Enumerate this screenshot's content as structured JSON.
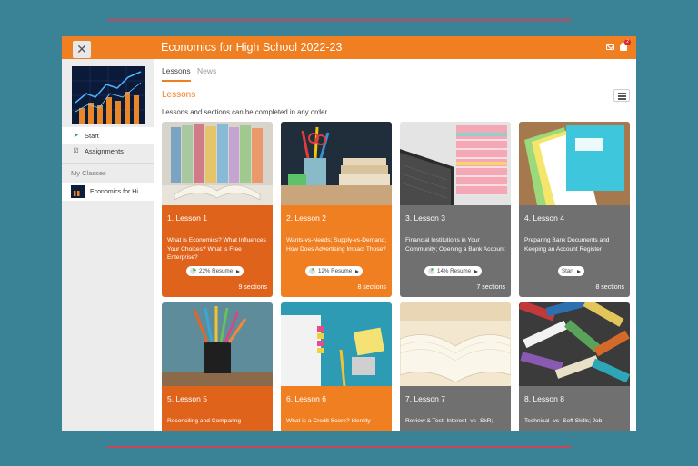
{
  "header": {
    "close_label": "✕",
    "title": "Economics for High School 2022-23",
    "notification_count": "2"
  },
  "sidebar": {
    "items": [
      {
        "label": "Start",
        "icon": "navigate-arrow-icon"
      },
      {
        "label": "Assignments",
        "icon": "checkbox-icon"
      }
    ],
    "my_classes_label": "My Classes",
    "classes": [
      {
        "label": "Economics for Hi"
      }
    ]
  },
  "tabs": [
    {
      "label": "Lessons",
      "active": true
    },
    {
      "label": "News",
      "active": false
    }
  ],
  "main": {
    "section_title": "Lessons",
    "helper_text": "Lessons and sections can be completed in any order."
  },
  "lessons": [
    {
      "title": "1. Lesson 1",
      "description": "What is Economics? What Influences Your Choices? What is Free Enterprise?",
      "button": "22% Resume",
      "progress": 22,
      "sections": "9 sections"
    },
    {
      "title": "2. Lesson 2",
      "description": "Wants-vs-Needs; Supply-vs-Demand; How Does Advertising Impact Those?",
      "button": "12% Resume",
      "progress": 12,
      "sections": "8 sections"
    },
    {
      "title": "3. Lesson 3",
      "description": "Financial Institutions in Your Community; Opening a Bank Account",
      "button": "14% Resume",
      "progress": 14,
      "sections": "7 sections"
    },
    {
      "title": "4. Lesson 4",
      "description": "Preparing Bank Documents and Keeping an Account Register",
      "button": "Start",
      "progress": 0,
      "sections": "8 sections"
    },
    {
      "title": "5. Lesson 5",
      "description": "Reconciling and Comparing"
    },
    {
      "title": "6. Lesson 6",
      "description": "What is a Credit Score? Identity"
    },
    {
      "title": "7. Lesson 7",
      "description": "Review & Test; Interest -vs- SkR;"
    },
    {
      "title": "8. Lesson 8",
      "description": "Technical -vs- Soft Skills; Job"
    }
  ],
  "colors": {
    "accent": "#f07f22",
    "card_dark_orange": "#e0631c",
    "card_gray": "#707070",
    "background": "#3a8295"
  }
}
